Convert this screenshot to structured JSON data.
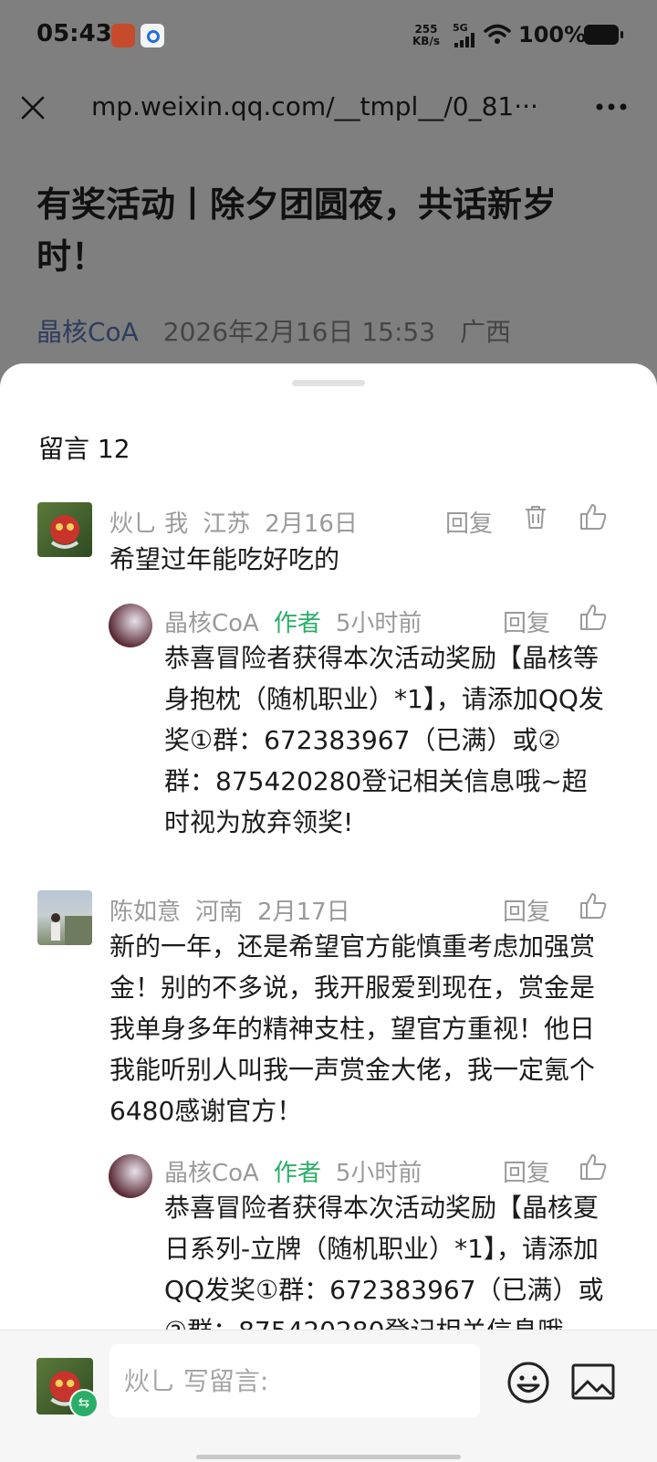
{
  "status_bar": {
    "time": "05:43",
    "net_speed_value": "255",
    "net_speed_unit": "KB/s",
    "network": "5G",
    "battery": "100%"
  },
  "nav": {
    "url": "mp.weixin.qq.com/__tmpl__/0_81···"
  },
  "article": {
    "title": "有奖活动丨除夕团圆夜，共话新岁时！",
    "author": "晶核CoA",
    "datetime": "2026年2月16日 15:53",
    "location": "广西"
  },
  "comments_panel": {
    "title": "留言 12",
    "reply_label": "回复",
    "author_tag": "作者",
    "comments": [
      {
        "user": "炏乚 我",
        "location": "江苏",
        "date": "2月16日",
        "text": "希望过年能吃好吃的",
        "reply": {
          "user": "晶核CoA",
          "time": "5小时前",
          "text": "恭喜冒险者获得本次活动奖励【晶核等身抱枕（随机职业）*1】，请添加QQ发奖①群：672383967（已满）或②群：875420280登记相关信息哦~超时视为放弃领奖!"
        }
      },
      {
        "user": "陈如意",
        "location": "河南",
        "date": "2月17日",
        "text": "新的一年，还是希望官方能慎重考虑加强赏金！别的不多说，我开服爱到现在，赏金是我单身多年的精神支柱，望官方重视！他日我能听别人叫我一声赏金大佬，我一定氪个6480感谢官方！",
        "reply": {
          "user": "晶核CoA",
          "time": "5小时前",
          "text": "恭喜冒险者获得本次活动奖励【晶核夏日系列-立牌（随机职业）*1】，请添加QQ发奖①群：672383967（已满）或②群：875420280登记相关信息哦"
        }
      }
    ]
  },
  "input_bar": {
    "placeholder": "炏乚 写留言:"
  }
}
